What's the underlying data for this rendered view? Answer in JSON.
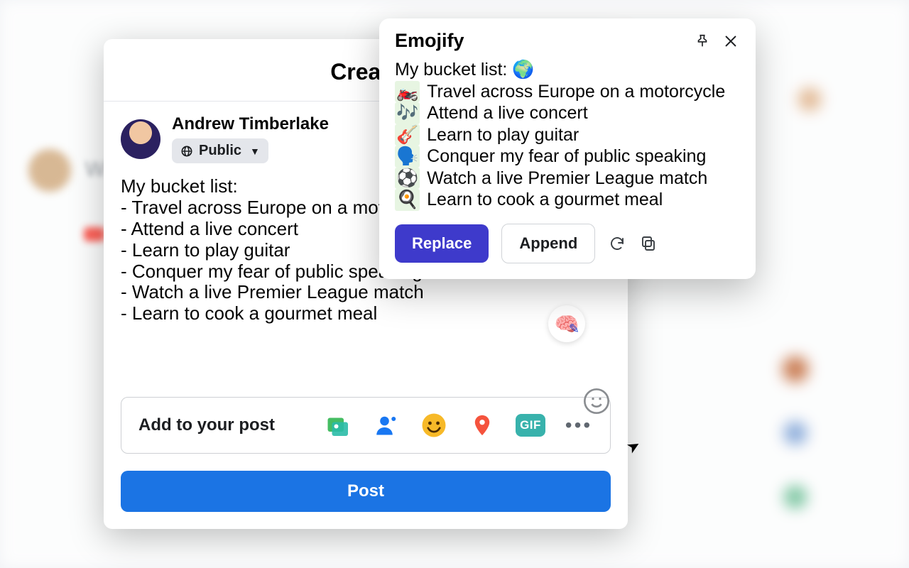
{
  "dialog": {
    "title": "Create",
    "user_name": "Andrew Timberlake",
    "audience_label": "Public",
    "post_text": "My bucket list:\n- Travel across Europe on a motorcy\n- Attend a live concert\n- Learn to play guitar\n- Conquer my fear of public speaking\n- Watch a live Premier League match\n- Learn to cook a gourmet meal",
    "add_label": "Add to your post",
    "gif_label": "GIF",
    "post_button": "Post"
  },
  "popover": {
    "title": "Emojify",
    "lines": [
      {
        "emoji": "",
        "text": "My bucket list: 🌍",
        "plain": true
      },
      {
        "emoji": "🏍️",
        "text": "Travel across Europe on a motorcycle"
      },
      {
        "emoji": "🎶",
        "text": "Attend a live concert"
      },
      {
        "emoji": "🎸",
        "text": "Learn to play guitar"
      },
      {
        "emoji": "🗣️",
        "text": "Conquer my fear of public speaking"
      },
      {
        "emoji": "⚽",
        "text": "Watch a live Premier League match"
      },
      {
        "emoji": "🍳",
        "text": "Learn to cook a gourmet meal"
      }
    ],
    "replace_label": "Replace",
    "append_label": "Append"
  },
  "bg": {
    "hint_text": "W"
  }
}
